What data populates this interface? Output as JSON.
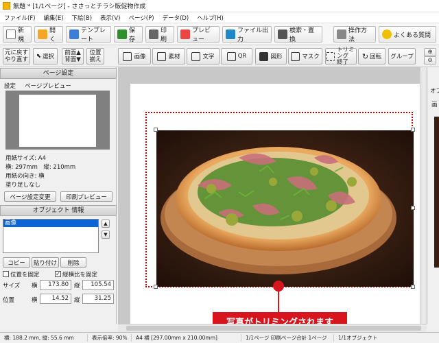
{
  "window": {
    "title": "無題 * [1/1ページ] - ささっとチラシ販促物作成"
  },
  "menu": [
    "ファイル(F)",
    "編集(E)",
    "下絵(B)",
    "表示(V)",
    "ページ(P)",
    "データ(D)",
    "ヘルプ(H)"
  ],
  "toolbar1": {
    "new": "新規",
    "open": "開く",
    "template": "テンプレート",
    "save": "保存",
    "print": "印刷",
    "preview": "プレビュー",
    "export": "ファイル出力",
    "search": "検索・置換",
    "howto": "操作方法",
    "faq": "よくある質問"
  },
  "toolbar2": {
    "undo": "元に戻す",
    "redo": "やり直す",
    "select": "選択",
    "front": "前面▲",
    "back": "背面▼",
    "align_1": "位置",
    "align_2": "揃え",
    "image": "画像",
    "material": "素材",
    "text": "文字",
    "qr": "QR",
    "shape": "図形",
    "mask": "マスク",
    "trim_1": "トリミング",
    "trim_2": "終了",
    "rotate": "回転",
    "group": "グループ"
  },
  "page_settings": {
    "header": "ページ設定",
    "tab_settings": "設定",
    "tab_preview": "ページプレビュー",
    "paper_size": "用紙サイズ: A4",
    "dimensions": "横: 297mm　縦: 210mm",
    "orientation": "用紙の向き: 横",
    "bleed": "塗り足しなし",
    "change_button": "ページ設定変更",
    "print_preview_button": "印刷プレビュー"
  },
  "object_info": {
    "header": "オブジェクト 情報",
    "list_items": [
      "画像"
    ],
    "copy": "コピー",
    "paste": "貼り付け",
    "delete": "削除",
    "fix_position": "位置を固定",
    "fix_ratio": "縦横比を固定",
    "size_label": "サイズ",
    "position_label": "位置",
    "width_label": "横",
    "height_label": "縦",
    "size_w": "173.80",
    "size_h": "105.54",
    "pos_x": "14.52",
    "pos_y": "31.25"
  },
  "annotation": "写真がトリミングされます",
  "right_panel": {
    "label_1": "オブ",
    "label_2": "画"
  },
  "status": {
    "coords": "横: 188.2 mm, 縦: 55.6 mm",
    "zoom": "表示倍率: 90%",
    "paper": "A4 横 [297.00mm x 210.00mm]",
    "page": "1/1ページ 印刷ページ合計 1ページ",
    "objects": "1/1オブジェクト"
  },
  "colors": {
    "accent": "#d8141f",
    "selection": "#c00000"
  }
}
